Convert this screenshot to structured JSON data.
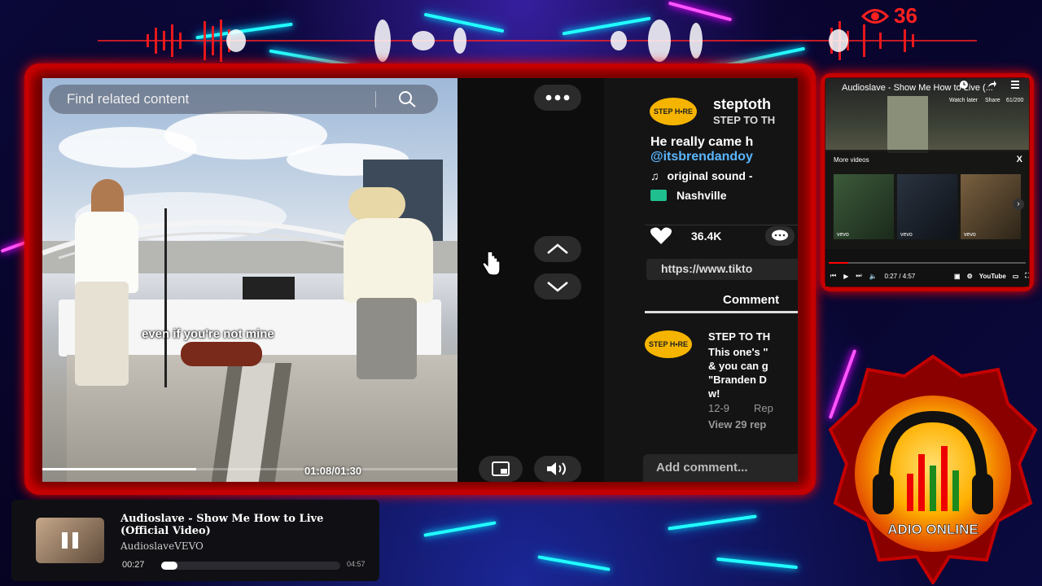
{
  "overlay": {
    "viewer_count": "36",
    "viewer_icon": "eye-icon",
    "badge_text": "ADIO ONLINE"
  },
  "tiktok": {
    "search_placeholder": "Find related content",
    "caption": "even if you're not mine",
    "time": "01:08/01:30",
    "progress_fraction": 0.37,
    "author_handle": "steptoth",
    "author_name": "STEP TO TH",
    "description": "He really came h",
    "mention": "@itsbrendandoy",
    "sound": "original sound -",
    "location": "Nashville",
    "likes": "36.4K",
    "share_url": "https://www.tikto",
    "comments_tab": "Comment",
    "logo_text": "STEP H•RE",
    "comment": {
      "author": "STEP TO TH",
      "lines": [
        "This one's \"",
        "& you can g",
        "\"Branden D",
        "w!"
      ],
      "date": "12-9",
      "reply": "Rep",
      "view_replies": "View 29 rep"
    },
    "add_comment": "Add comment..."
  },
  "youtube": {
    "title": "Audioslave - Show Me How to Live (...",
    "watch_later": "Watch later",
    "share": "Share",
    "counter": "61/200",
    "more_videos": "More videos",
    "close": "X",
    "time": "0:27 / 4:57",
    "logo": "YouTube",
    "thumb_labels": [
      "vevo",
      "vevo",
      "vevo"
    ],
    "played_fraction": 0.1
  },
  "now_playing": {
    "title": "Audioslave - Show Me How to Live (Official Video)",
    "artist": "AudioslaveVEVO",
    "elapsed": "00:27",
    "duration": "04:57",
    "played_fraction": 0.09
  }
}
